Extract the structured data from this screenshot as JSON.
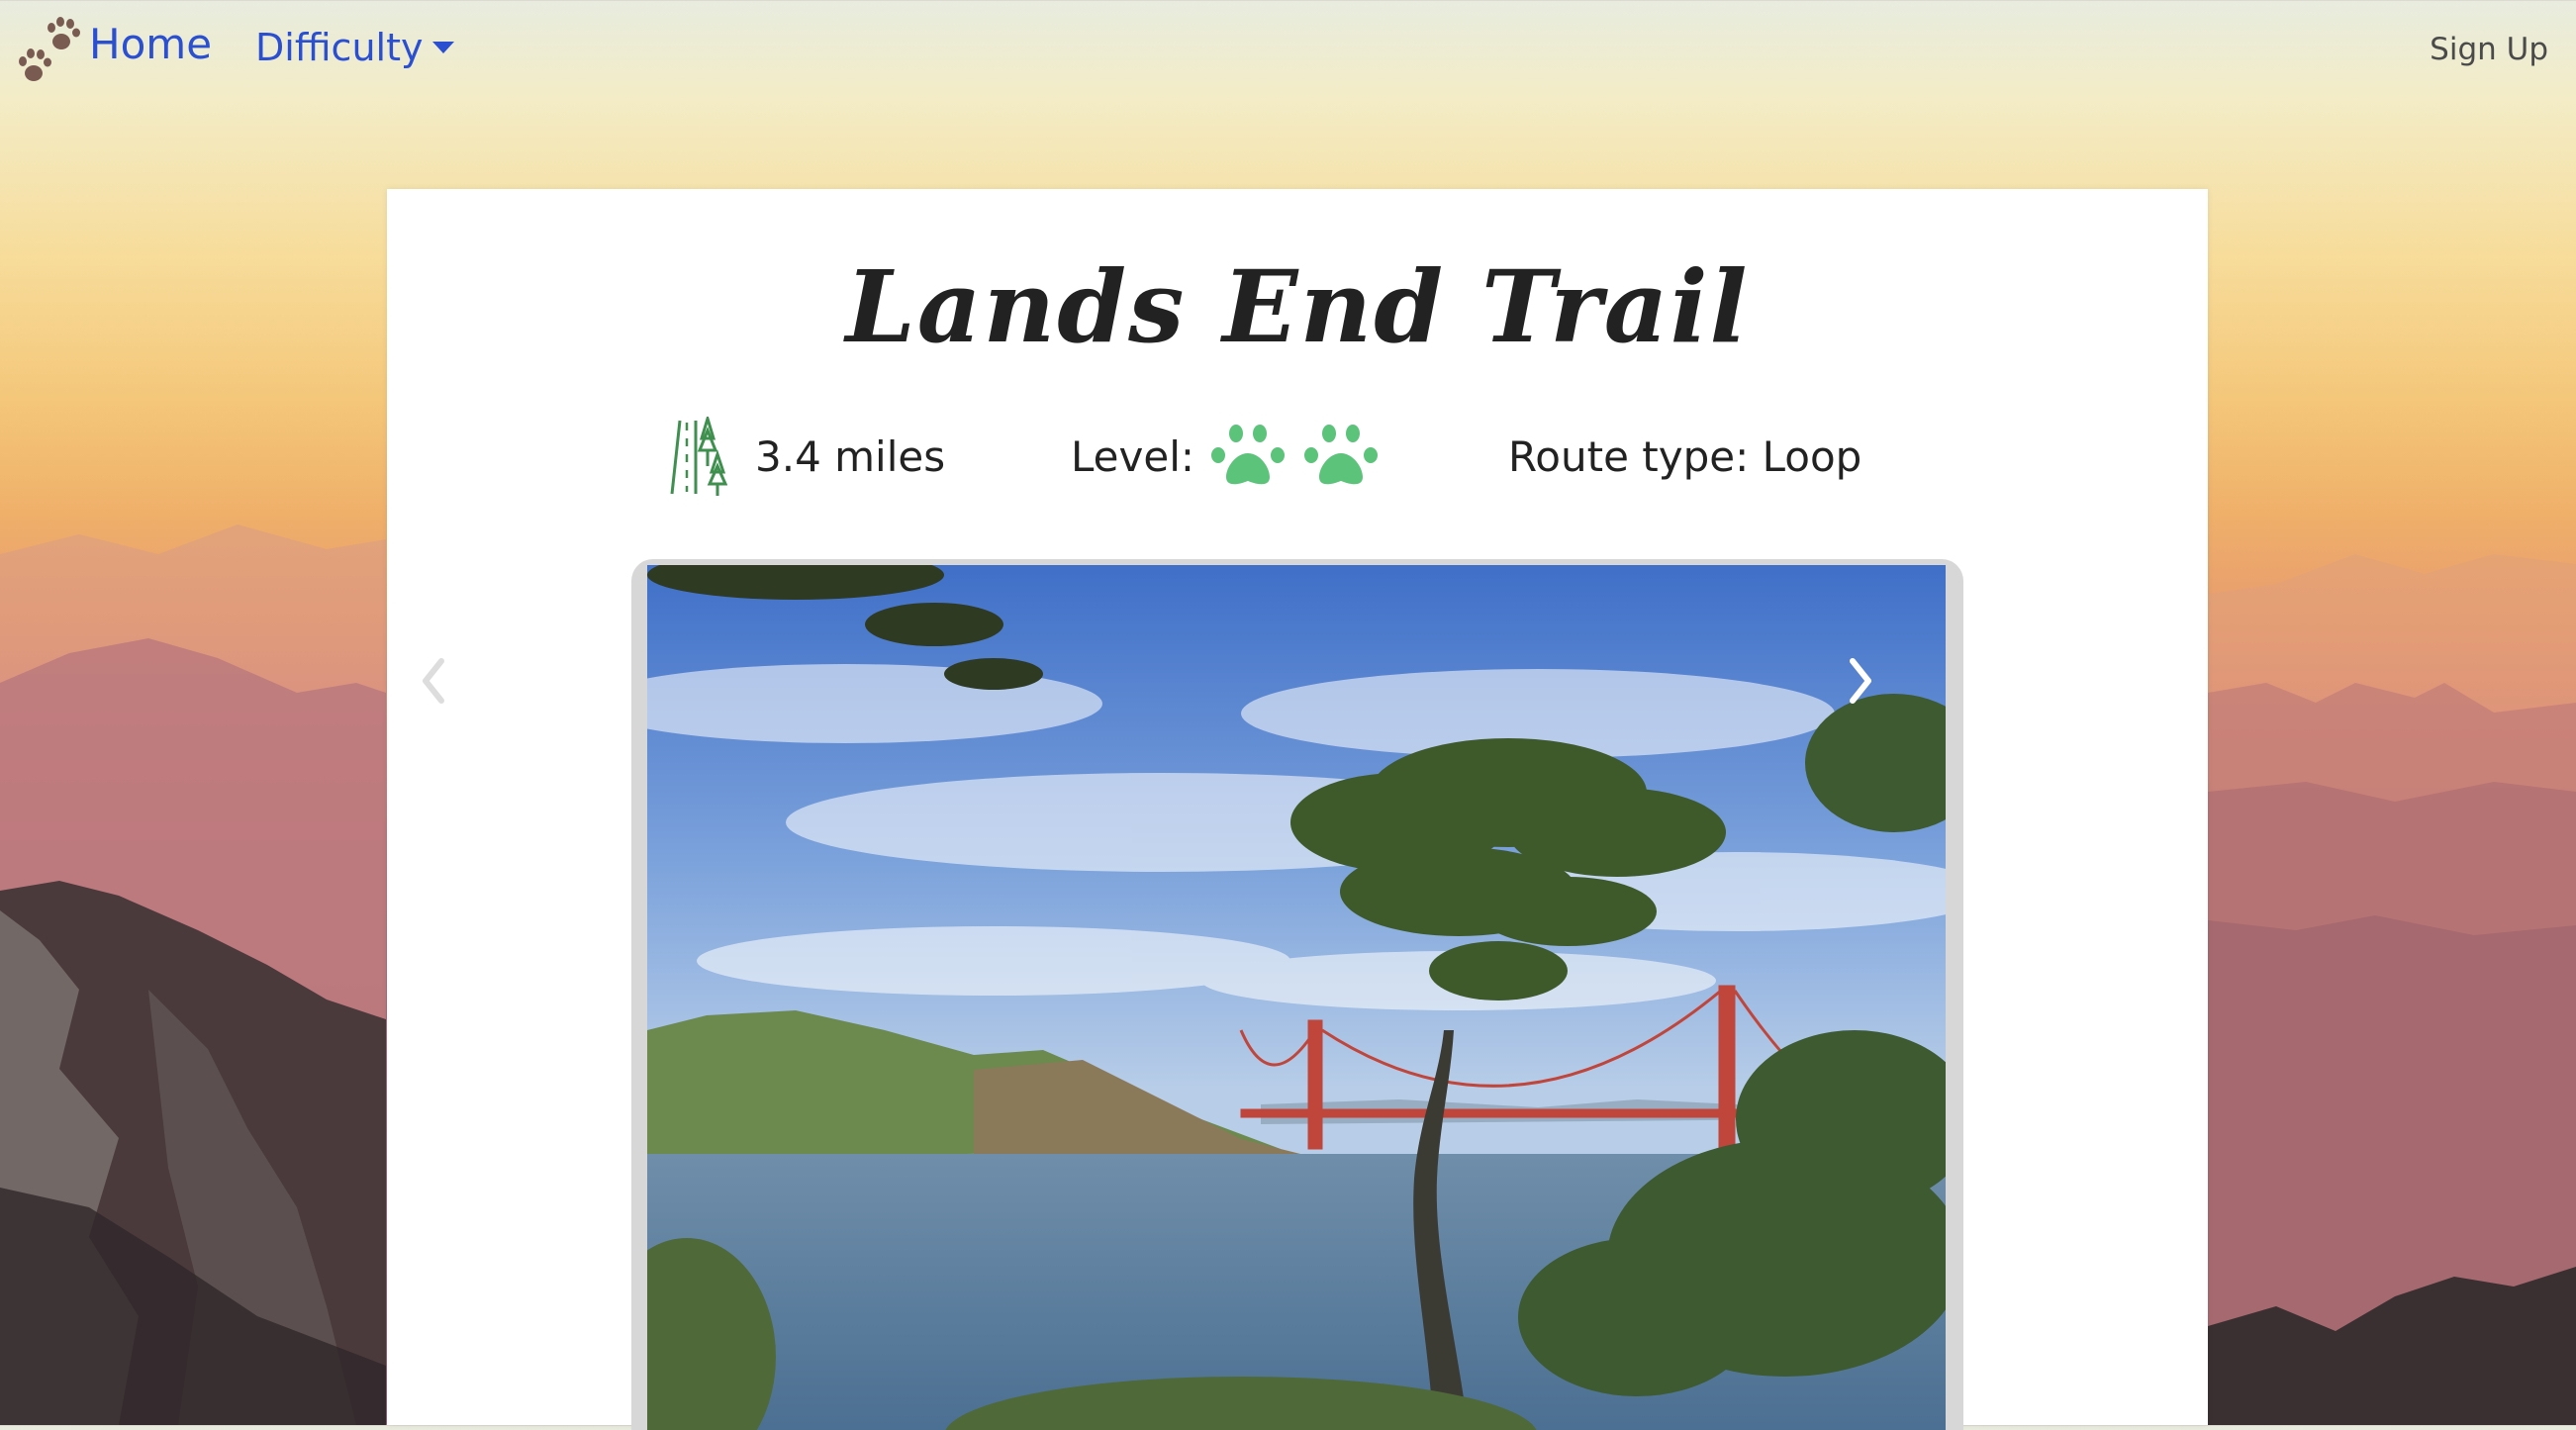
{
  "nav": {
    "brand_icon": "paw-prints-icon",
    "home_label": "Home",
    "difficulty_label": "Difficulty",
    "signup_label": "Sign Up"
  },
  "trail": {
    "title": "Lands End Trail",
    "distance": "3.4 miles",
    "level_label": "Level:",
    "level_paws": 2,
    "route_type": "Route type: Loop"
  },
  "carousel": {
    "prev_icon": "chevron-left-icon",
    "next_icon": "chevron-right-icon",
    "image_subject": "Golden Gate Bridge seen through cypress trees"
  },
  "colors": {
    "nav_link": "#2a4fd1",
    "paw_green": "#5cc37a",
    "trail_icon_green": "#3f8f4f",
    "brand_paw": "#7a5b52"
  }
}
